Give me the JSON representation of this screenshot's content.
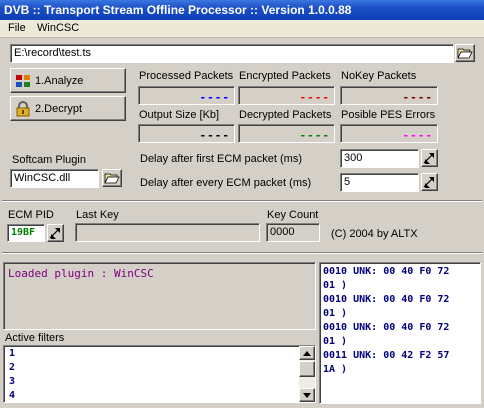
{
  "window": {
    "title": "DVB :: Transport Stream Offline Processor :: Version 1.0.0.88"
  },
  "menu": {
    "file": "File",
    "wincsc": "WinCSC"
  },
  "input_file": {
    "value": "E:\\record\\test.ts"
  },
  "buttons": {
    "analyze": "1.Analyze",
    "decrypt": "2.Decrypt"
  },
  "stats": {
    "processed_packets": {
      "label": "Processed Packets",
      "value": "----",
      "color": "#0000ff"
    },
    "encrypted_packets": {
      "label": "Encrypted Packets",
      "value": "----",
      "color": "#ff0000"
    },
    "nokey_packets": {
      "label": "NoKey Packets",
      "value": "----",
      "color": "#800000"
    },
    "output_size": {
      "label": "Output Size [Kb]",
      "value": "----",
      "color": "#000000"
    },
    "decrypted_packets": {
      "label": "Decrypted Packets",
      "value": "----",
      "color": "#008000"
    },
    "possible_pes_errors": {
      "label": "Posible PES Errors",
      "value": "----",
      "color": "#ff00ff"
    }
  },
  "softcam": {
    "label": "Softcam Plugin",
    "value": "WinCSC.dll"
  },
  "delays": {
    "first_ecm": {
      "label": "Delay after first ECM packet (ms)",
      "value": "300"
    },
    "every_ecm": {
      "label": "Delay after every ECM packet (ms)",
      "value": "5"
    }
  },
  "ecm": {
    "pid_label": "ECM PID",
    "pid_value": "19BF",
    "pid_color": "#008000",
    "last_key_label": "Last Key",
    "last_key_value": "",
    "key_count_label": "Key Count",
    "key_count_value": "0000",
    "copyright": "(C) 2004 by ALTX"
  },
  "log": {
    "lines": [
      "Loaded plugin : WinCSC"
    ],
    "color": "#800080"
  },
  "filters": {
    "label": "Active filters",
    "items": [
      "1",
      "2",
      "3",
      "4"
    ],
    "color": "#000080"
  },
  "hex_log": {
    "color": "#000080",
    "lines": [
      "0010 UNK: 00 40 F0 72",
      "01 )",
      "0010 UNK: 00 40 F0 72",
      "01 )",
      "0010 UNK: 00 40 F0 72",
      "01 )",
      "0011 UNK: 00 42 F2 57",
      "1A )"
    ]
  }
}
